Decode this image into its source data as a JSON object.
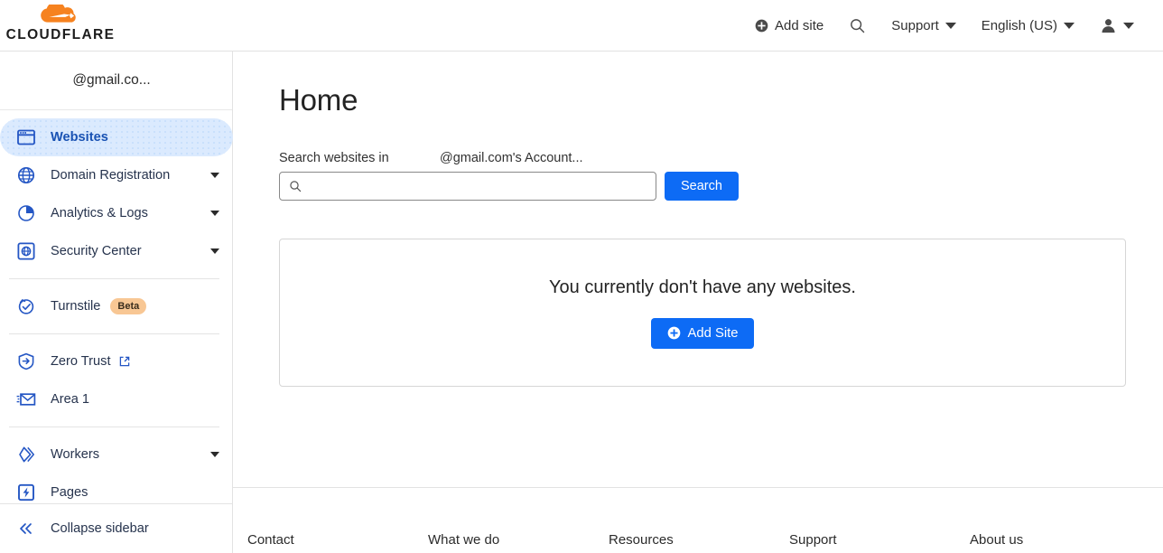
{
  "header": {
    "brand": "CLOUDFLARE",
    "brand_icon": "cloudflare-cloud-logo",
    "nav": [
      {
        "label": "Add site",
        "icon": "plus-circle-icon",
        "has_caret": false
      },
      {
        "label": "",
        "icon": "search-icon",
        "has_caret": false
      },
      {
        "label": "Support",
        "icon": "",
        "has_caret": true
      },
      {
        "label": "English (US)",
        "icon": "",
        "has_caret": true
      },
      {
        "label": "",
        "icon": "user-avatar-icon",
        "has_caret": true
      }
    ]
  },
  "sidebar": {
    "account": "@gmail.co...",
    "items": [
      {
        "label": "Websites",
        "icon": "browser-window-icon",
        "active": true,
        "caret": false,
        "badge": "",
        "external": false
      },
      {
        "label": "Domain Registration",
        "icon": "globe-icon",
        "active": false,
        "caret": true,
        "badge": "",
        "external": false
      },
      {
        "label": "Analytics & Logs",
        "icon": "pie-chart-icon",
        "active": false,
        "caret": true,
        "badge": "",
        "external": false
      },
      {
        "label": "Security Center",
        "icon": "security-shield-icon",
        "active": false,
        "caret": true,
        "badge": "",
        "external": false
      },
      {
        "label": "Turnstile",
        "icon": "turnstile-check-icon",
        "active": false,
        "caret": false,
        "badge": "Beta",
        "external": false
      },
      {
        "label": "Zero Trust",
        "icon": "zero-trust-shield-icon",
        "active": false,
        "caret": false,
        "badge": "",
        "external": true
      },
      {
        "label": "Area 1",
        "icon": "envelope-icon",
        "active": false,
        "caret": false,
        "badge": "",
        "external": false
      },
      {
        "label": "Workers",
        "icon": "workers-diamond-icon",
        "active": false,
        "caret": true,
        "badge": "",
        "external": false
      },
      {
        "label": "Pages",
        "icon": "pages-bolt-icon",
        "active": false,
        "caret": false,
        "badge": "",
        "external": false
      }
    ],
    "collapse": {
      "label": "Collapse sidebar",
      "icon": "double-chevron-left-icon"
    }
  },
  "main": {
    "title": "Home",
    "search_label": "Search websites in",
    "account_scope": "@gmail.com's Account...",
    "search_value": "",
    "search_placeholder": "",
    "search_button": "Search",
    "empty_message": "You currently don't have any websites.",
    "add_site_button": "Add Site"
  },
  "footer": {
    "columns": [
      "Contact",
      "What we do",
      "Resources",
      "Support",
      "About us"
    ]
  },
  "colors": {
    "accent_blue": "#0d6bf5",
    "brand_orange": "#f6821f",
    "active_nav_bg": "#dbeafe",
    "active_nav_text": "#1952b3",
    "beta_badge_bg": "#f8c794",
    "icon_blue": "#2456c4"
  }
}
